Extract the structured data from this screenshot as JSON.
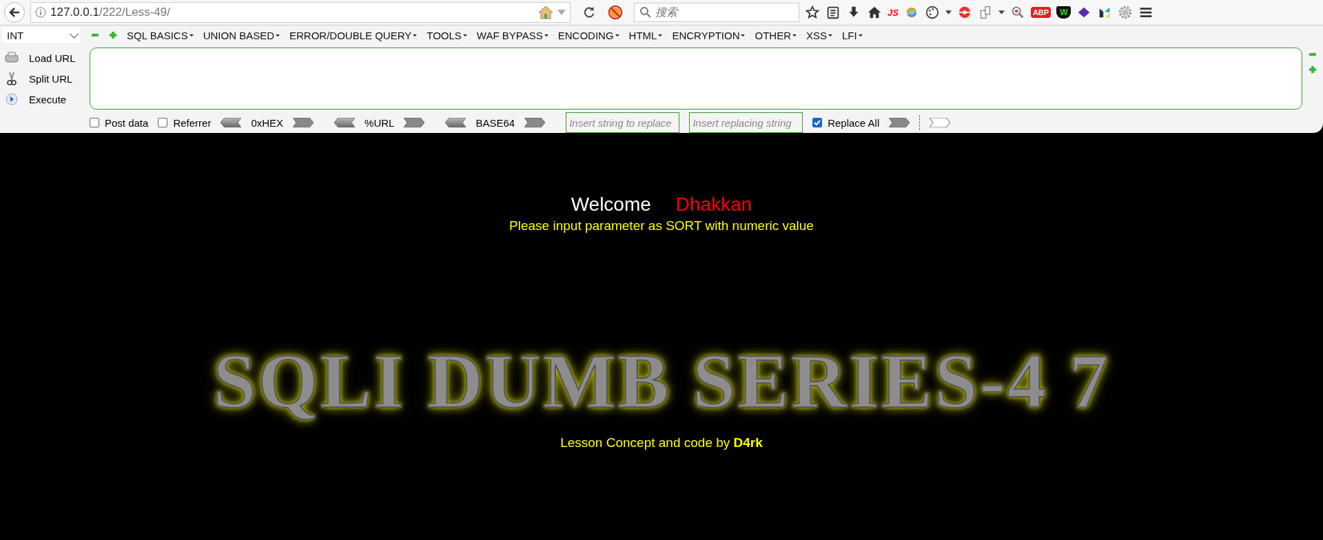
{
  "browser": {
    "url_host": "127.0.0.1",
    "url_path": "/222/Less-49/",
    "search_placeholder": "搜索",
    "toolbar_icons": [
      {
        "kind": "star"
      },
      {
        "kind": "reader"
      },
      {
        "kind": "download"
      },
      {
        "kind": "home"
      },
      {
        "kind": "badge",
        "text": "JS"
      },
      {
        "kind": "sync"
      },
      {
        "kind": "palette"
      },
      {
        "kind": "caret"
      },
      {
        "kind": "redball"
      },
      {
        "kind": "pages"
      },
      {
        "kind": "caret"
      },
      {
        "kind": "magnifier"
      },
      {
        "kind": "badge",
        "text": "ABP"
      },
      {
        "kind": "shield",
        "text": "W"
      },
      {
        "kind": "diamond"
      },
      {
        "kind": "logo"
      },
      {
        "kind": "gear"
      },
      {
        "kind": "menu"
      }
    ]
  },
  "hackbar": {
    "select": "INT",
    "menus": [
      "SQL BASICS",
      "UNION BASED",
      "ERROR/DOUBLE QUERY",
      "TOOLS",
      "WAF BYPASS",
      "ENCODING",
      "HTML",
      "ENCRYPTION",
      "OTHER",
      "XSS",
      "LFI"
    ],
    "actions": [
      {
        "kind": "load",
        "label": "Load URL"
      },
      {
        "kind": "split",
        "label": "Split URL"
      },
      {
        "kind": "execute",
        "label": "Execute"
      }
    ],
    "options": [
      {
        "kind": "checkbox",
        "label": "Post data",
        "checked": false
      },
      {
        "kind": "checkbox",
        "label": "Referrer",
        "checked": false
      },
      {
        "kind": "encoder",
        "label": "0xHEX"
      },
      {
        "kind": "encoder",
        "label": "%URL"
      },
      {
        "kind": "encoder",
        "label": "BASE64"
      },
      {
        "kind": "field",
        "placeholder": "Insert string to replace"
      },
      {
        "kind": "field",
        "placeholder": "Insert replacing string"
      },
      {
        "kind": "checkbox",
        "label": "Replace All",
        "checked": true
      },
      {
        "kind": "replace"
      }
    ]
  },
  "page": {
    "welcome": "Welcome",
    "name": "Dhakkan",
    "instruction": "Please input parameter as SORT with numeric value",
    "title": "SQLI DUMB SERIES-4 7",
    "credit": "Lesson Concept and code by **D4rk**"
  }
}
